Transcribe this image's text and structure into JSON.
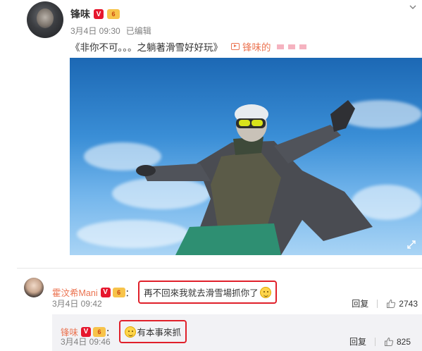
{
  "post": {
    "author": "锋味",
    "badge_v": "V",
    "badge_lv": "6",
    "time": "3月4日 09:30",
    "edited": "已编辑",
    "text": "《非你不可。。。之躺著滑雪好好玩》",
    "video_link_label": "锋味的"
  },
  "comment": {
    "author": "霍汶希Mani",
    "badge_v": "V",
    "badge_lv": "6",
    "colon": "：",
    "text": "再不回來我就去滑雪場抓你了",
    "time": "3月4日 09:42",
    "reply_label": "回复",
    "like_count": "2743"
  },
  "reply": {
    "author": "锋味",
    "badge_v": "V",
    "badge_lv": "6",
    "colon": "：",
    "text": "有本事來抓",
    "time": "3月4日 09:46",
    "reply_label": "回复",
    "like_count": "825"
  },
  "colors": {
    "accent_name": "#eb7350",
    "highlight_box": "#e0202a",
    "sky": "#3a8ed6"
  },
  "icons": [
    "avatar",
    "verified-icon",
    "level-badge-icon",
    "chevron-down-icon",
    "video-link-icon",
    "fullscreen-icon",
    "thumb-up-icon",
    "smile-emoji-icon"
  ]
}
